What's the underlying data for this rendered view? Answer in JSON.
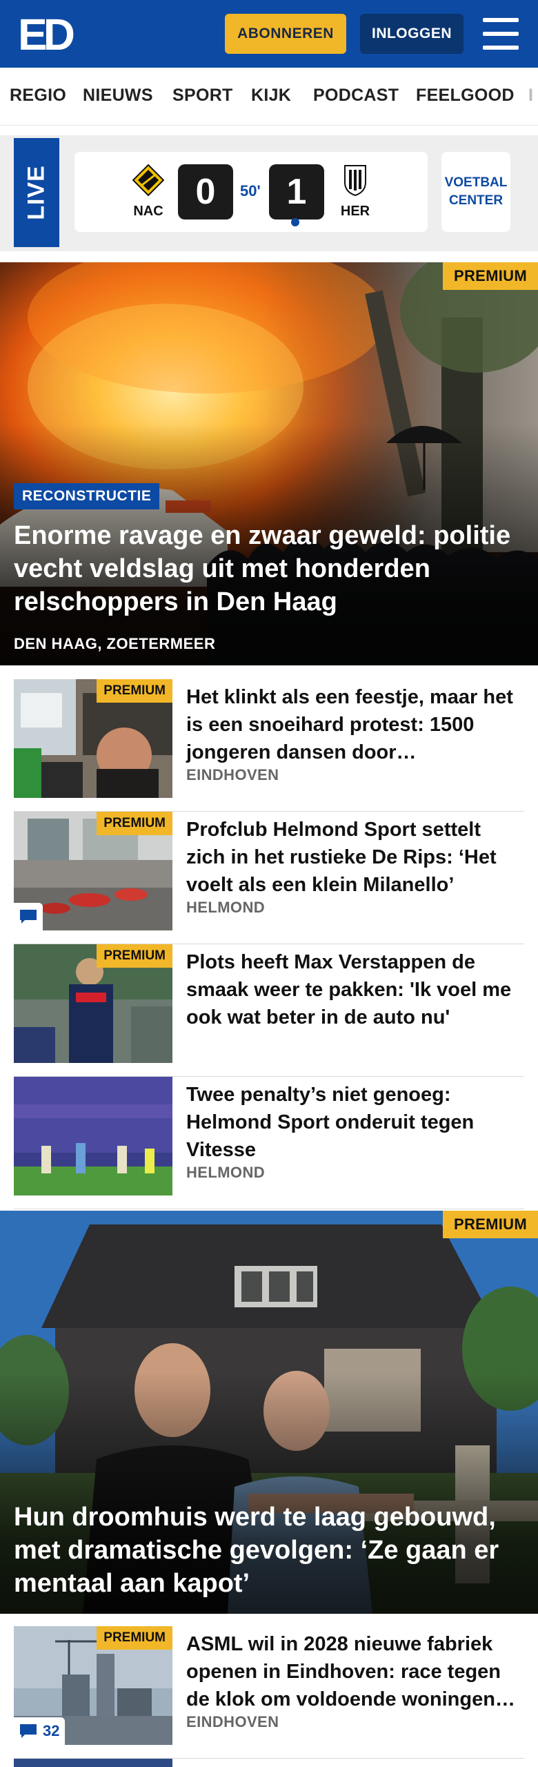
{
  "header": {
    "logo_text": "ED",
    "subscribe_label": "ABONNEREN",
    "login_label": "INLOGGEN",
    "colors": {
      "brand": "#0d4aa3",
      "accent": "#f2b728"
    }
  },
  "nav": {
    "items": [
      "REGIO",
      "NIEUWS",
      "SPORT",
      "KIJK",
      "PODCAST",
      "FEELGOOD",
      "I"
    ]
  },
  "live": {
    "tag": "LIVE",
    "home_team": "NAC",
    "home_score": "0",
    "minute": "50'",
    "away_score": "1",
    "away_team": "HER",
    "center_line1": "VOETBAL",
    "center_line2": "CENTER"
  },
  "hero1": {
    "badge": "PREMIUM",
    "label": "RECONSTRUCTIE",
    "title": "Enorme ravage en zwaar geweld: politie vecht veldslag uit met honderden relschoppers in Den Haag",
    "location": "DEN HAAG, ZOETERMEER"
  },
  "articles": [
    {
      "badge": "PREMIUM",
      "title": "Het klinkt als een feestje, maar het is een snoeihard protest: 1500 jongeren dansen door…",
      "location": "EINDHOVEN"
    },
    {
      "badge": "PREMIUM",
      "title": "Profclub Helmond Sport settelt zich in het rustieke De Rips: ‘Het voelt als een klein Milanello’",
      "location": "HELMOND",
      "comments": ""
    },
    {
      "badge": "PREMIUM",
      "title": "Plots heeft Max Verstappen de smaak weer te pakken: 'Ik voel me ook wat beter in de auto nu'"
    },
    {
      "title": "Twee penalty’s niet genoeg: Helmond Sport onderuit tegen Vitesse",
      "location": "HELMOND"
    }
  ],
  "hero2": {
    "badge": "PREMIUM",
    "title": "Hun droomhuis werd te laag gebouwd, met dramatische gevolgen: ‘Ze gaan er mentaal aan kapot’"
  },
  "articles2": [
    {
      "badge": "PREMIUM",
      "title": "ASML wil in 2028 nieuwe fabriek openen in Eindhoven: race tegen de klok om voldoende woningen…",
      "location": "EINDHOVEN",
      "comments": "32"
    }
  ]
}
